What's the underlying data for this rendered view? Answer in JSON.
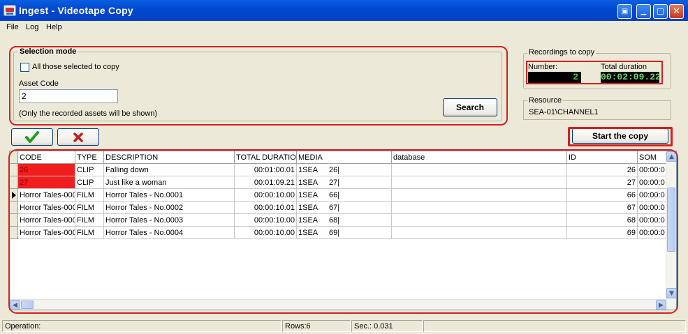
{
  "window": {
    "title": "Ingest - Videotape Copy"
  },
  "menu": [
    "File",
    "Log",
    "Help"
  ],
  "selection": {
    "caption": "Selection mode",
    "checkbox_label": "All those selected to copy",
    "asset_code_label": "Asset Code",
    "asset_code_value": "2",
    "hint": "(Only the recorded assets will be shown)",
    "search_label": "Search"
  },
  "recordings": {
    "caption": "Recordings to copy",
    "number_label": "Number:",
    "number_value": "2",
    "duration_label": "Total duration",
    "duration_value": "00:02:09.22"
  },
  "resource": {
    "caption": "Resource",
    "value": "SEA-01\\CHANNEL1"
  },
  "actions": {
    "confirm_icon": "checkmark-icon",
    "cancel_icon": "cross-icon",
    "start_label": "Start the copy"
  },
  "colors": {
    "highlight": "#D42020",
    "code_red": "#F01E1E",
    "lcd_green": "#3CD23C"
  },
  "grid": {
    "headers": [
      "CODE",
      "TYPE",
      "DESCRIPTION",
      "TOTAL DURATIO",
      "MEDIA",
      "database",
      "ID",
      "SOM"
    ],
    "rows": [
      {
        "code": "26",
        "type": "CLIP",
        "description": "Falling down",
        "duration": "00:01:00.01",
        "media": "1SEA",
        "media_no": "26|",
        "database": "",
        "id": "26",
        "som": "00:00:0",
        "red": true,
        "current": false
      },
      {
        "code": "27",
        "type": "CLIP",
        "description": "Just like a woman",
        "duration": "00:01:09.21",
        "media": "1SEA",
        "media_no": "27|",
        "database": "",
        "id": "27",
        "som": "00:00:0",
        "red": true,
        "current": false
      },
      {
        "code": "Horror Tales-000",
        "type": "FILM",
        "description": "Horror Tales - No.0001",
        "duration": "00:00:10.00",
        "media": "1SEA",
        "media_no": "66|",
        "database": "",
        "id": "66",
        "som": "00:00:0",
        "red": false,
        "current": true
      },
      {
        "code": "Horror Tales-000",
        "type": "FILM",
        "description": "Horror Tales - No.0002",
        "duration": "00:00:10.01",
        "media": "1SEA",
        "media_no": "67|",
        "database": "",
        "id": "67",
        "som": "00:00:0",
        "red": false,
        "current": false
      },
      {
        "code": "Horror Tales-000",
        "type": "FILM",
        "description": "Horror Tales - No.0003",
        "duration": "00:00:10.00",
        "media": "1SEA",
        "media_no": "68|",
        "database": "",
        "id": "68",
        "som": "00:00:0",
        "red": false,
        "current": false
      },
      {
        "code": "Horror Tales-000",
        "type": "FILM",
        "description": "Horror Tales - No.0004",
        "duration": "00:00:10.00",
        "media": "1SEA",
        "media_no": "69|",
        "database": "",
        "id": "69",
        "som": "00:00:0",
        "red": false,
        "current": false
      }
    ]
  },
  "status": {
    "operation": "Operation:",
    "rows": "Rows:6",
    "sec": "Sec.: 0.031"
  }
}
